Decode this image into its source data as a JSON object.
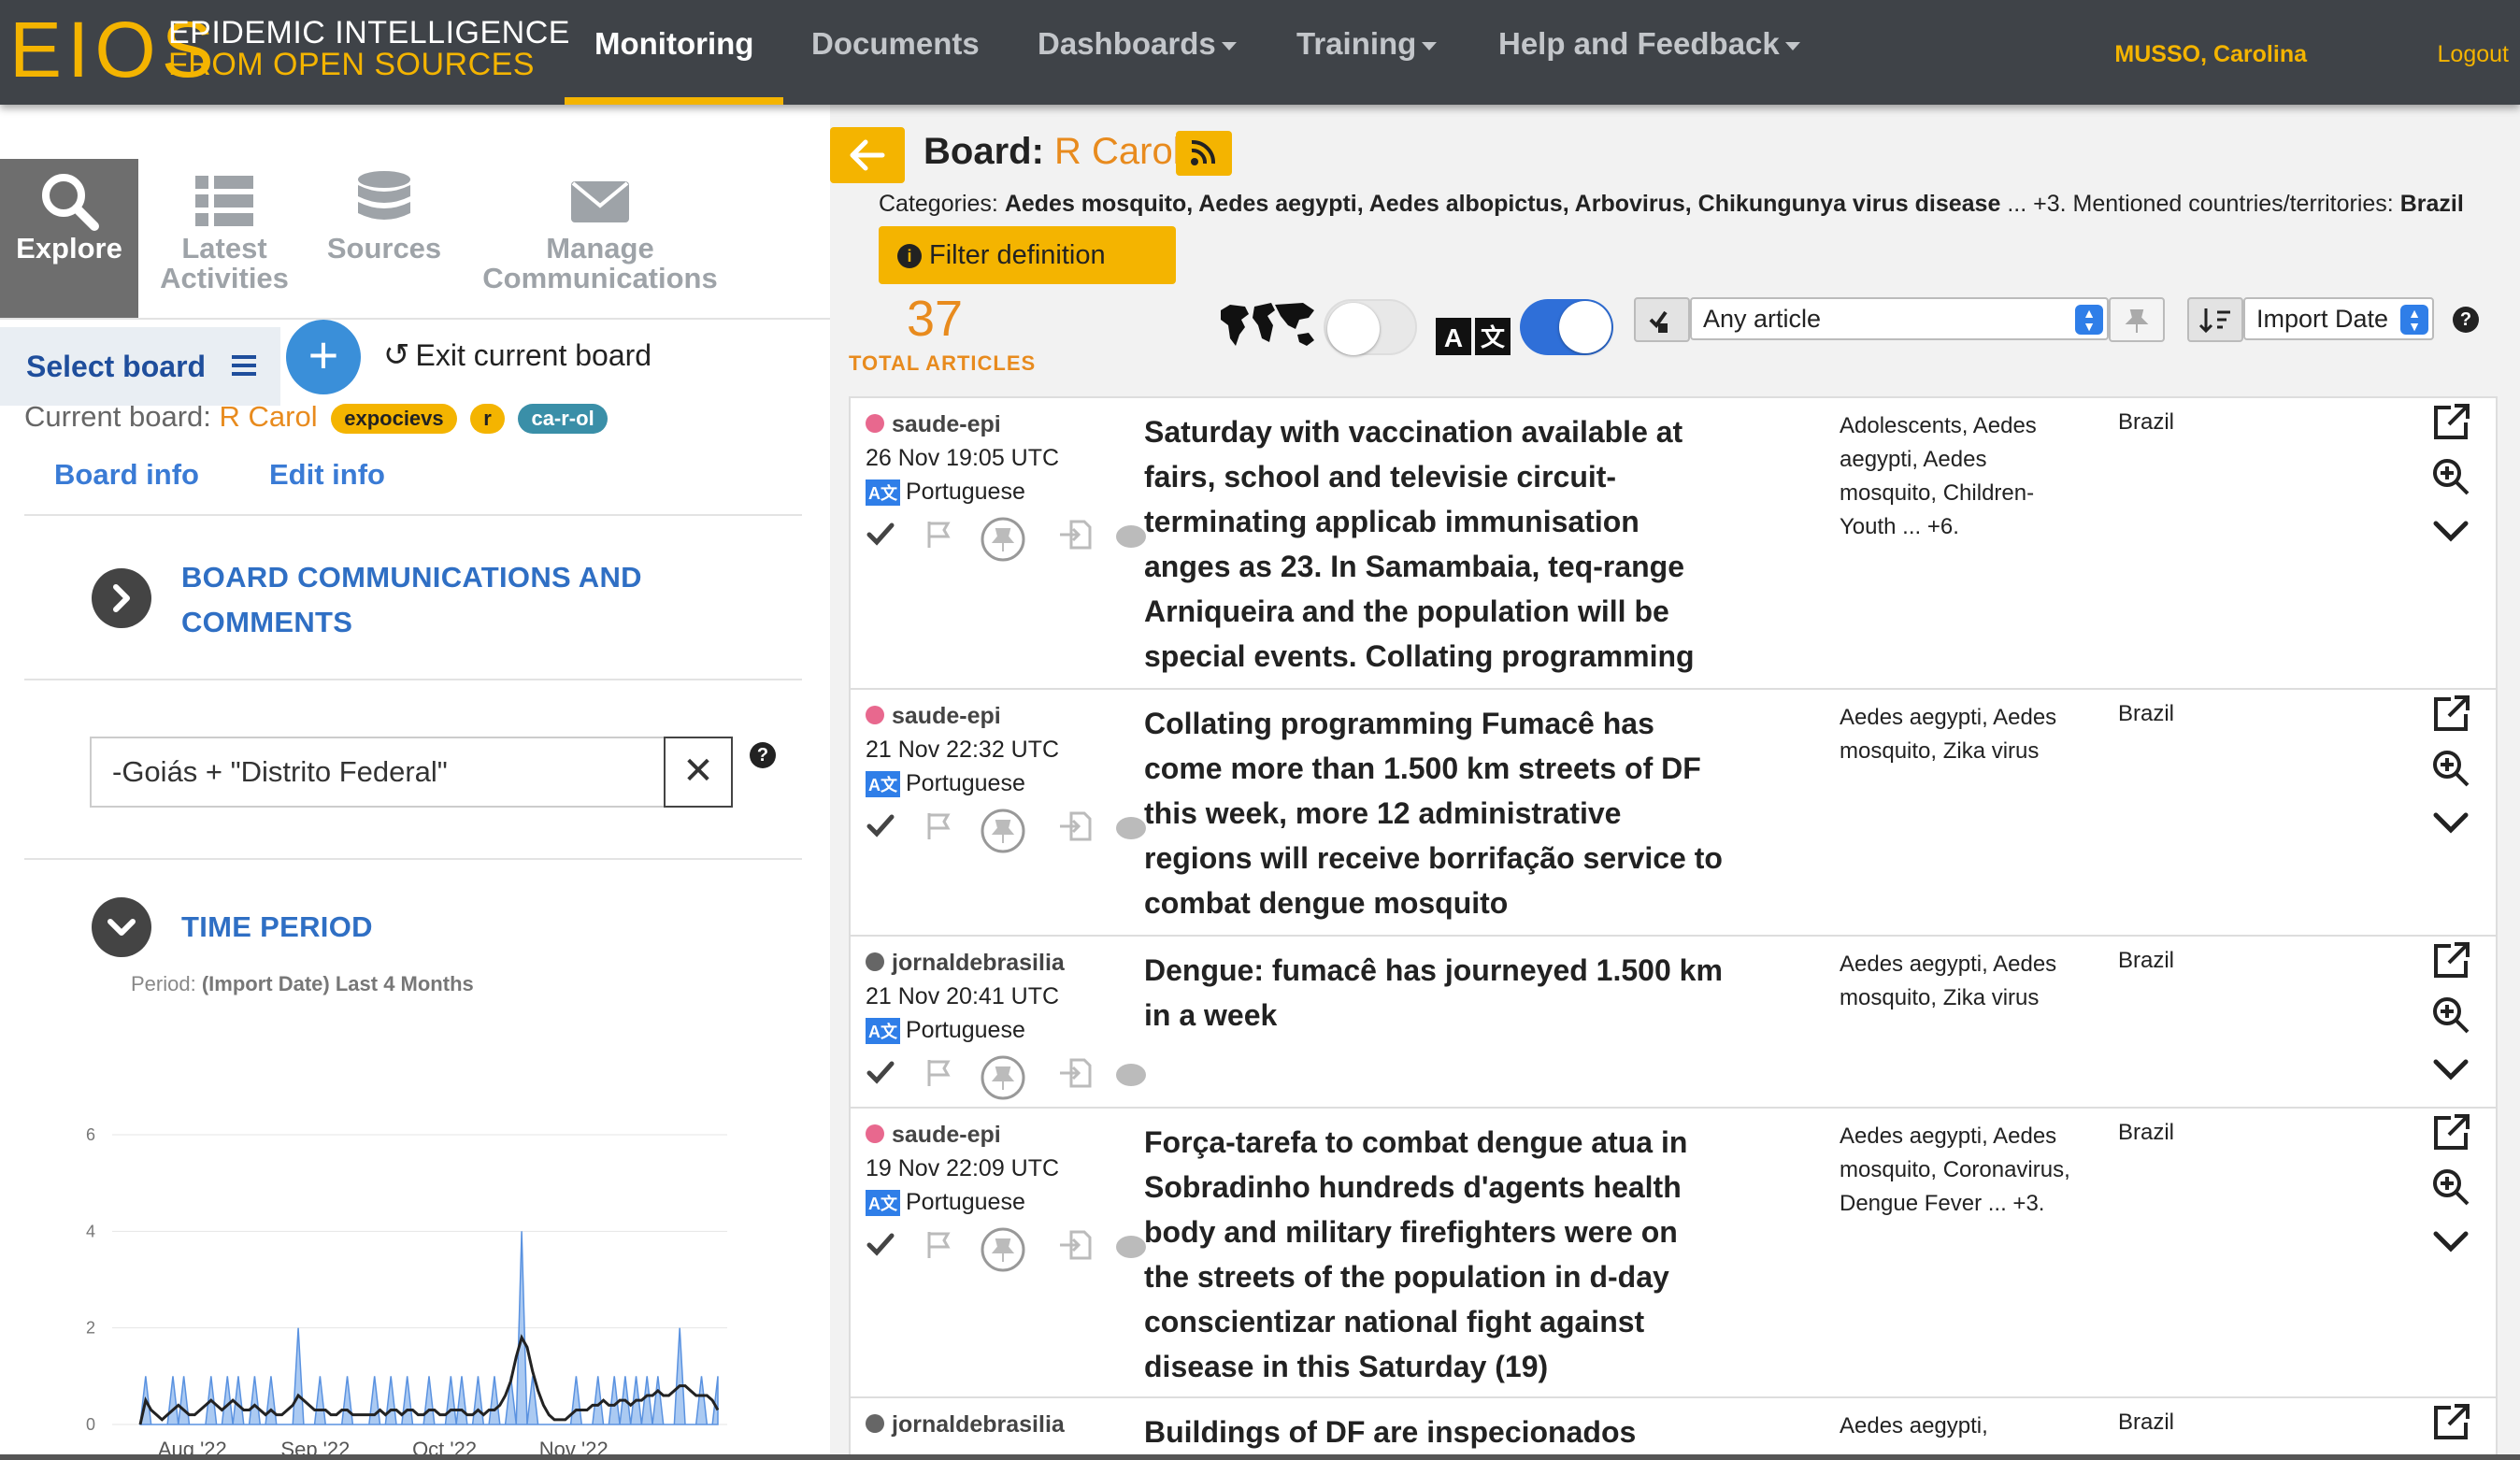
{
  "navbar": {
    "logo_mark": "EIOS",
    "logo_line1": "EPIDEMIC INTELLIGENCE",
    "logo_line2": "FROM OPEN SOURCES",
    "items": [
      {
        "label": "Monitoring",
        "active": true
      },
      {
        "label": "Documents",
        "active": false
      },
      {
        "label": "Dashboards",
        "dropdown": true
      },
      {
        "label": "Training",
        "dropdown": true
      },
      {
        "label": "Help and Feedback",
        "dropdown": true
      }
    ],
    "user": "MUSSO, Carolina",
    "logout": "Logout",
    "accent_color": "#f4b400"
  },
  "left": {
    "tabs": [
      {
        "label": "Explore",
        "icon": "search-icon",
        "active": true
      },
      {
        "label": "Latest Activities",
        "icon": "list-icon"
      },
      {
        "label": "Sources",
        "icon": "database-icon"
      },
      {
        "label": "Manage Communications",
        "icon": "envelope-icon"
      }
    ],
    "select_board": "Select board",
    "exit_board": "Exit current board",
    "current_board_label": "Current board:",
    "current_board_name": "R Carol",
    "badges": [
      "expocievs",
      "r",
      "ca-r-ol"
    ],
    "board_info": "Board info",
    "edit_info": "Edit info",
    "communications_title_1": "BOARD COMMUNICATIONS AND",
    "communications_title_2": "COMMENTS",
    "search_value": "-Goiás + \"Distrito Federal\"",
    "time_period_title": "TIME PERIOD",
    "period_label": "Period:",
    "period_value": "(Import Date) Last 4 Months"
  },
  "chart_data": {
    "type": "area",
    "x_ticks": [
      "Aug '22",
      "Sep '22",
      "Oct '22",
      "Nov '22"
    ],
    "y_ticks": [
      0,
      2,
      4,
      6
    ],
    "ylim": [
      0,
      6
    ],
    "series": [
      {
        "values": [
          0,
          1,
          0,
          0,
          0,
          0,
          1,
          0,
          1,
          0,
          0,
          0,
          0,
          1,
          0,
          0,
          1,
          0,
          1,
          0,
          0,
          1,
          0,
          0,
          1,
          0,
          0,
          0,
          0,
          2,
          0,
          0,
          0,
          1,
          0,
          0,
          0,
          0,
          1,
          0,
          0,
          0,
          0,
          1,
          0,
          0,
          1,
          0,
          0,
          1,
          0,
          0,
          0,
          1,
          0,
          0,
          0,
          1,
          0,
          1,
          0,
          0,
          1,
          0,
          0,
          1,
          0,
          0,
          1,
          0,
          4,
          0,
          1,
          0,
          0,
          0,
          0,
          0,
          0,
          0,
          1,
          0,
          0,
          0,
          1,
          0,
          0,
          1,
          0,
          1,
          0,
          1,
          0,
          1,
          0,
          1,
          0,
          0,
          0,
          2,
          0,
          0,
          0,
          1,
          0,
          0,
          1
        ],
        "color": "#8fb8ee"
      },
      {
        "values": [
          0,
          0.5,
          0.3,
          0.2,
          0.1,
          0.2,
          0.3,
          0.4,
          0.3,
          0.2,
          0.2,
          0.3,
          0.4,
          0.5,
          0.4,
          0.3,
          0.4,
          0.5,
          0.4,
          0.3,
          0.3,
          0.4,
          0.3,
          0.2,
          0.3,
          0.2,
          0.2,
          0.3,
          0.4,
          0.6,
          0.5,
          0.4,
          0.3,
          0.3,
          0.3,
          0.2,
          0.2,
          0.3,
          0.3,
          0.2,
          0.2,
          0.2,
          0.2,
          0.2,
          0.3,
          0.2,
          0.3,
          0.3,
          0.2,
          0.3,
          0.3,
          0.2,
          0.2,
          0.3,
          0.3,
          0.2,
          0.2,
          0.3,
          0.3,
          0.3,
          0.2,
          0.2,
          0.3,
          0.2,
          0.3,
          0.3,
          0.4,
          0.6,
          0.9,
          1.4,
          1.8,
          1.6,
          1.1,
          0.7,
          0.4,
          0.2,
          0.1,
          0.1,
          0.1,
          0.2,
          0.3,
          0.3,
          0.3,
          0.4,
          0.4,
          0.5,
          0.4,
          0.4,
          0.5,
          0.5,
          0.4,
          0.5,
          0.5,
          0.6,
          0.6,
          0.7,
          0.6,
          0.6,
          0.7,
          0.8,
          0.8,
          0.7,
          0.6,
          0.6,
          0.6,
          0.5,
          0.3
        ],
        "color": "#222"
      }
    ]
  },
  "right": {
    "board_prefix": "Board:",
    "board_name": "R Carol",
    "categories_label": "Categories:",
    "categories": "Aedes mosquito, Aedes aegypti, Aedes albopictus, Arbovirus, Chikungunya virus disease",
    "categories_more": "... +3.",
    "countries_label": "Mentioned countries/territories:",
    "countries": "Brazil",
    "filter_button": "Filter definition",
    "total": "37",
    "total_label": "TOTAL ARTICLES",
    "article_filter": "Any article",
    "sort_by": "Import Date",
    "map_toggle_on": false,
    "translate_toggle_on": true
  },
  "articles": [
    {
      "source": "saude-epi",
      "source_color": "#e8688e",
      "date": "26 Nov 19:05 UTC",
      "language": "Portuguese",
      "title": "Saturday with vaccination available at fairs, school and televisie circuit-terminating applicab immunisation anges as 23. In Samambaia, teq-range Arniqueira and the population will be special events. Collating programming",
      "topics": "Adolescents, Aedes aegypti, Aedes mosquito, Children-Youth ... +6.",
      "country": "Brazil"
    },
    {
      "source": "saude-epi",
      "source_color": "#e8688e",
      "date": "21 Nov 22:32 UTC",
      "language": "Portuguese",
      "title": "Collating programming Fumacê has come more than 1.500 km streets of DF this week, more 12 administrative regions will receive borrifação service to combat dengue mosquito",
      "topics": "Aedes aegypti, Aedes mosquito, Zika virus",
      "country": "Brazil"
    },
    {
      "source": "jornaldebrasilia",
      "source_color": "#666",
      "date": "21 Nov 20:41 UTC",
      "language": "Portuguese",
      "title": "Dengue: fumacê has journeyed 1.500 km in a week",
      "topics": "Aedes aegypti, Aedes mosquito, Zika virus",
      "country": "Brazil"
    },
    {
      "source": "saude-epi",
      "source_color": "#e8688e",
      "date": "19 Nov 22:09 UTC",
      "language": "Portuguese",
      "title": "Força-tarefa to combat dengue atua in Sobradinho hundreds d'agents health body and military firefighters were on the streets of the population in d-day conscientizar national fight against disease in this Saturday (19)",
      "topics": "Aedes aegypti, Aedes mosquito, Coronavirus, Dengue Fever ... +3.",
      "country": "Brazil"
    },
    {
      "source": "jornaldebrasilia",
      "source_color": "#666",
      "date": "",
      "language": "",
      "title": "Buildings of DF are inspecionados",
      "topics": "Aedes aegypti,",
      "country": "Brazil"
    }
  ]
}
